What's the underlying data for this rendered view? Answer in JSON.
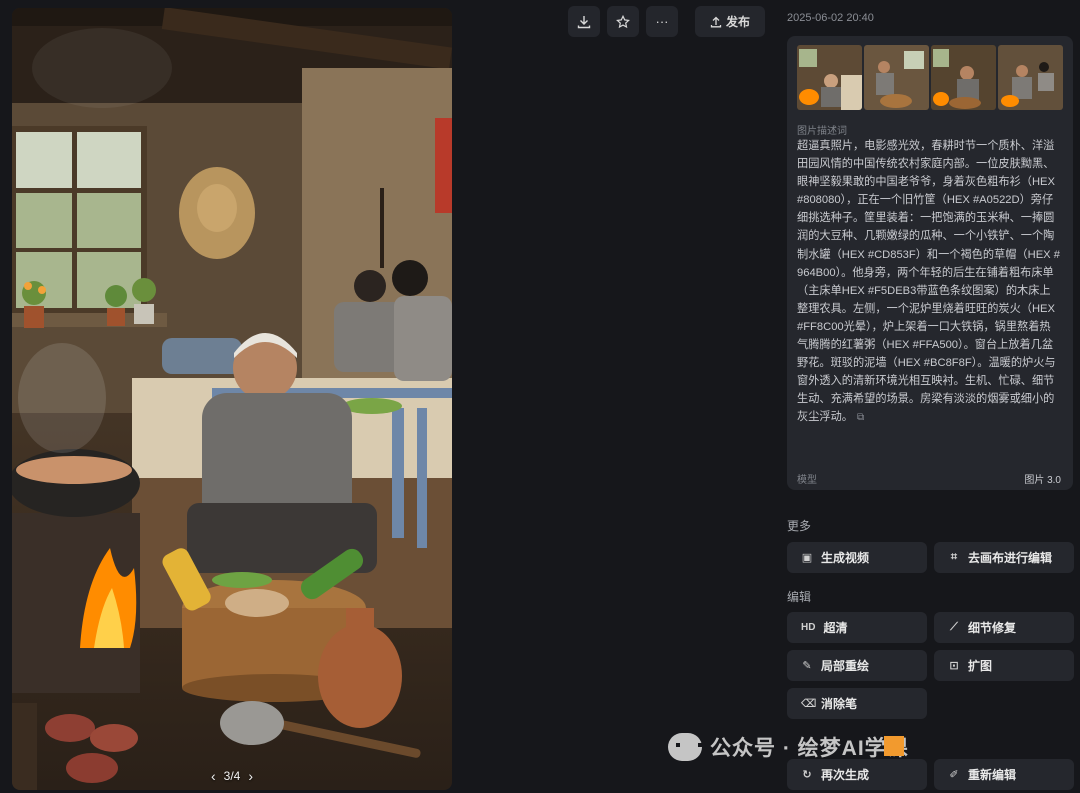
{
  "toolbar": {
    "download_icon": "download-icon",
    "favorite_icon": "star-icon",
    "more_icon": "more-icon",
    "publish_label": "发布"
  },
  "viewer": {
    "pager": "3/4",
    "prev_icon": "chevron-left-icon",
    "next_icon": "chevron-right-icon"
  },
  "info": {
    "timestamp": "2025-06-02 20:40",
    "desc_label": "图片描述词",
    "description": "超逼真照片，电影感光效，春耕时节一个质朴、洋溢田园风情的中国传统农村家庭内部。一位皮肤黝黑、眼神坚毅果敢的中国老爷爷，身着灰色粗布衫（HEX #808080），正在一个旧竹筐（HEX #A0522D）旁仔细挑选种子。筐里装着：一把饱满的玉米种、一捧圆润的大豆种、几颗嫩绿的瓜种、一个小铁铲、一个陶制水罐（HEX #CD853F）和一个褐色的草帽（HEX #964B00）。他身旁，两个年轻的后生在铺着粗布床单（主床单HEX #F5DEB3带蓝色条纹图案）的木床上整理农具。左侧，一个泥炉里烧着旺旺的炭火（HEX #FF8C00光晕），炉上架着一口大铁锅，锅里熬着热气腾腾的红薯粥（HEX #FFA500）。窗台上放着几盆野花。斑驳的泥墙（HEX #BC8F8F）。温暖的炉火与窗外透入的清新环境光相互映衬。生机、忙碌、细节生动、充满希望的场景。房梁有淡淡的烟雾或细小的灰尘浮动。",
    "model_label": "模型",
    "model_value": "图片 3.0"
  },
  "more": {
    "title": "更多",
    "generate_video": "生成视频",
    "canvas_edit": "去画布进行编辑"
  },
  "edit": {
    "title": "编辑",
    "upscale_badge": "HD",
    "upscale": "超清",
    "detail_fix": "细节修复",
    "inpaint": "局部重绘",
    "outpaint": "扩图",
    "eraser": "消除笔",
    "regenerate": "再次生成",
    "reedit": "重新编辑"
  },
  "watermark": {
    "text": "公众号 · 绘梦AI学课"
  }
}
